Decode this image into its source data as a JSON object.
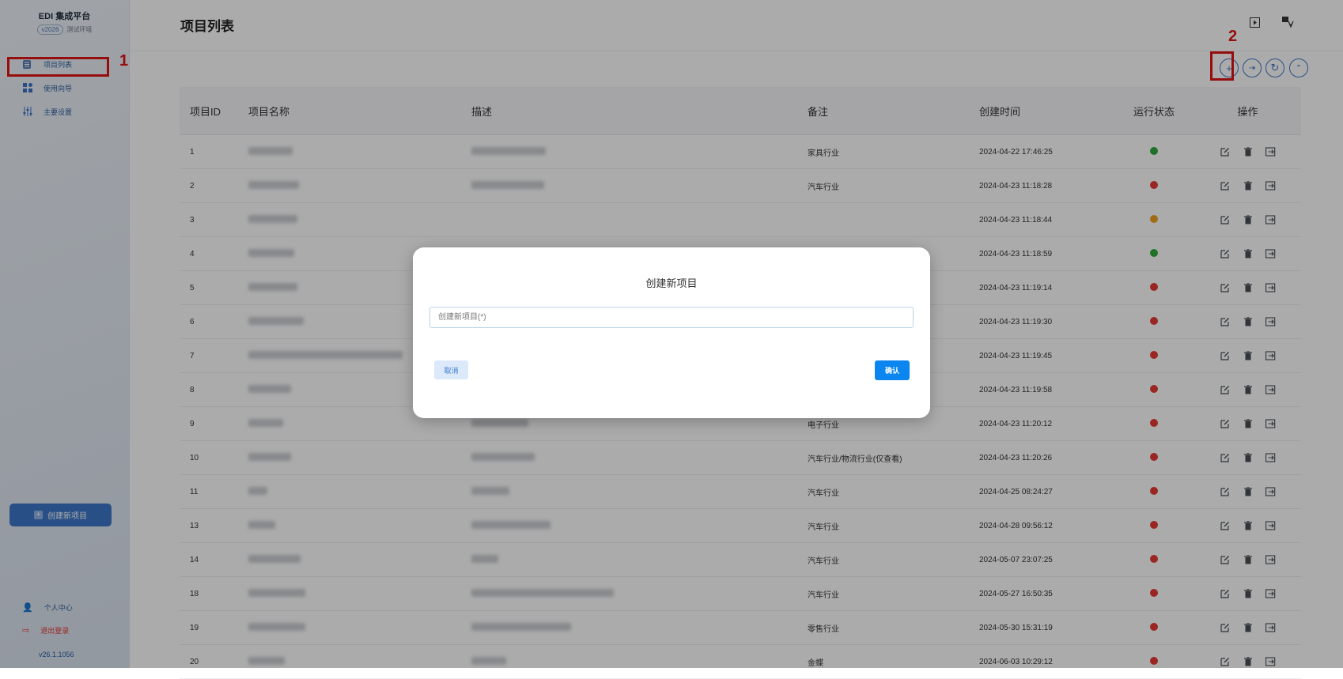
{
  "sidebar": {
    "brand": "EDI 集成平台",
    "version_pill": "v2026",
    "environment": "测试环境",
    "nav": [
      {
        "label": "项目列表",
        "icon": "list-icon"
      },
      {
        "label": "使用向导",
        "icon": "grid-icon"
      },
      {
        "label": "主要设置",
        "icon": "sliders-icon"
      }
    ],
    "create_button": "创建新项目",
    "personal_center": "个人中心",
    "logout": "退出登录",
    "version": "v26.1.1056"
  },
  "annotations": {
    "marker1": "1",
    "marker2": "2",
    "color": "#e01414"
  },
  "header": {
    "title": "项目列表"
  },
  "table": {
    "headers": [
      "项目ID",
      "项目名称",
      "描述",
      "备注",
      "创建时间",
      "运行状态",
      "操作"
    ],
    "rows": [
      {
        "id": "1",
        "note": "家具行业",
        "time": "2024-04-22 17:46:25",
        "status": "green"
      },
      {
        "id": "2",
        "note": "汽车行业",
        "time": "2024-04-23 11:18:28",
        "status": "red"
      },
      {
        "id": "3",
        "note": "",
        "time": "2024-04-23 11:18:44",
        "status": "orange"
      },
      {
        "id": "4",
        "note": "",
        "time": "2024-04-23 11:18:59",
        "status": "green"
      },
      {
        "id": "5",
        "note": "",
        "time": "2024-04-23 11:19:14",
        "status": "red"
      },
      {
        "id": "6",
        "note": "",
        "time": "2024-04-23 11:19:30",
        "status": "red"
      },
      {
        "id": "7",
        "note": "",
        "time": "2024-04-23 11:19:45",
        "status": "red"
      },
      {
        "id": "8",
        "note": "",
        "time": "2024-04-23 11:19:58",
        "status": "red"
      },
      {
        "id": "9",
        "note": "电子行业",
        "time": "2024-04-23 11:20:12",
        "status": "red"
      },
      {
        "id": "10",
        "note": "汽车行业/物流行业(仅查看)",
        "time": "2024-04-23 11:20:26",
        "status": "red"
      },
      {
        "id": "11",
        "note": "汽车行业",
        "time": "2024-04-25 08:24:27",
        "status": "red"
      },
      {
        "id": "13",
        "note": "汽车行业",
        "time": "2024-04-28 09:56:12",
        "status": "red"
      },
      {
        "id": "14",
        "note": "汽车行业",
        "time": "2024-05-07 23:07:25",
        "status": "red"
      },
      {
        "id": "18",
        "note": "汽车行业",
        "time": "2024-05-27 16:50:35",
        "status": "red"
      },
      {
        "id": "19",
        "note": "零售行业",
        "time": "2024-05-30 15:31:19",
        "status": "red"
      },
      {
        "id": "20",
        "note": "金蝶",
        "time": "2024-06-03 10:29:12",
        "status": "red"
      }
    ]
  },
  "status_colors": {
    "green": "#2eaa3a",
    "red": "#e53935",
    "orange": "#f0a020"
  },
  "modal": {
    "title": "创建新项目",
    "input_placeholder": "创建新项目(*)",
    "cancel": "取消",
    "confirm": "确认"
  }
}
